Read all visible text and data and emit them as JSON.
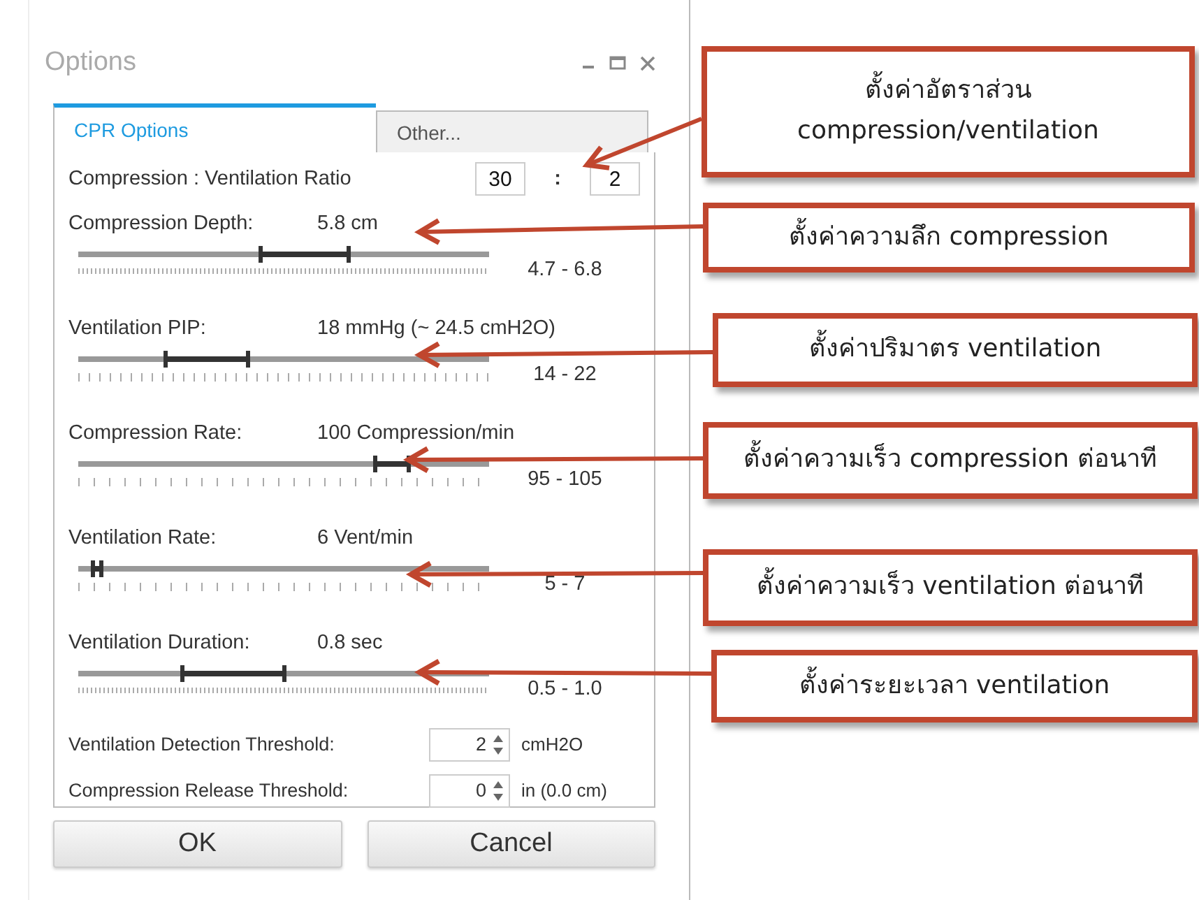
{
  "window": {
    "title": "Options"
  },
  "tabs": [
    {
      "label": "CPR Options",
      "selected": true
    },
    {
      "label": "Other...",
      "selected": false
    }
  ],
  "ratio": {
    "label": "Compression : Ventilation Ratio",
    "compression": "30",
    "separator": ":",
    "ventilation": "2"
  },
  "sliders": [
    {
      "label": "Compression Depth:",
      "value": "5.8 cm",
      "thumbs": [
        {
          "level": 0.44
        },
        {
          "level": 0.655
        }
      ],
      "range": "4.7 - 6.8"
    },
    {
      "label": "Ventilation PIP:",
      "value": "18 mmHg (~ 24.5 cmH2O)",
      "thumbs": [
        {
          "level": 0.21
        },
        {
          "level": 0.41
        }
      ],
      "range": "14 - 22"
    },
    {
      "label": "Compression Rate:",
      "value": "100 Compression/min",
      "thumbs": [
        {
          "level": 0.72
        },
        {
          "level": 0.8
        }
      ],
      "range": "95 - 105"
    },
    {
      "label": "Ventilation Rate:",
      "value": "6 Vent/min",
      "thumbs": [
        {
          "level": 0.035
        },
        {
          "level": 0.055
        }
      ],
      "range": "5 - 7"
    },
    {
      "label": "Ventilation Duration:",
      "value": "0.8 sec",
      "thumbs": [
        {
          "level": 0.25
        },
        {
          "level": 0.5
        }
      ],
      "range": "0.5 - 1.0"
    }
  ],
  "spinners": [
    {
      "label": "Ventilation Detection Threshold:",
      "value": "2",
      "unit": "cmH2O"
    },
    {
      "label": "Compression Release Threshold:",
      "value": "0",
      "unit": "in (0.0 cm)"
    }
  ],
  "buttons": [
    "OK",
    "Cancel"
  ],
  "callouts": [
    {
      "lines": [
        "ตั้งค่าอัตราส่วน",
        "compression/ventilation"
      ]
    },
    {
      "lines": [
        "ตั้งค่าความลึก compression"
      ]
    },
    {
      "lines": [
        "ตั้งค่าปริมาตร ventilation"
      ]
    },
    {
      "lines": [
        "ตั้งค่าความเร็ว compression ต่อนาที"
      ]
    },
    {
      "lines": [
        "ตั้งค่าความเร็ว ventilation ต่อนาที"
      ]
    },
    {
      "lines": [
        "ตั้งค่าระยะเวลา ventilation"
      ]
    }
  ]
}
